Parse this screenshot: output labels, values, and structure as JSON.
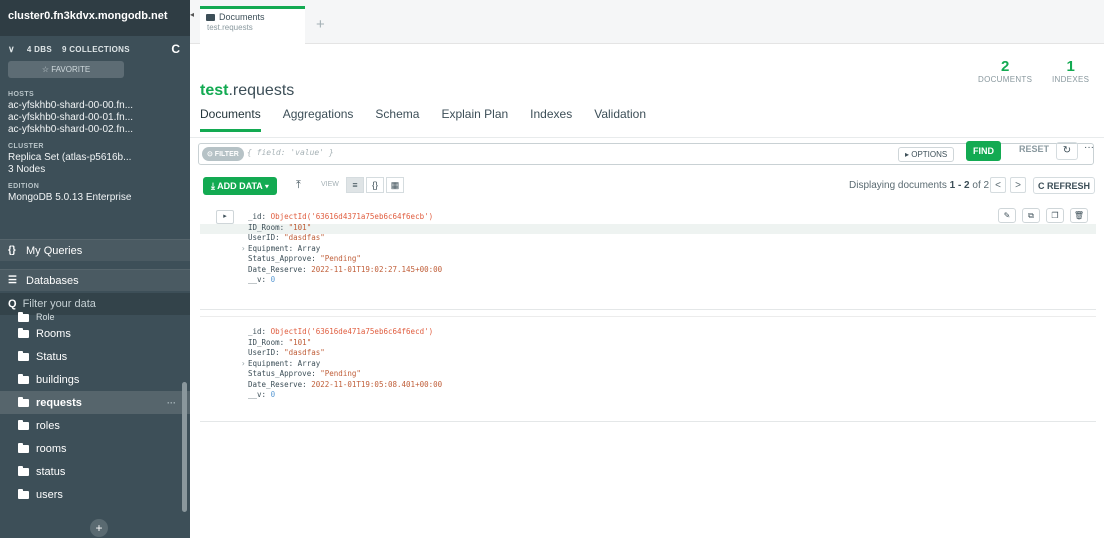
{
  "sidebar": {
    "cluster": "cluster0.fn3kdvx.mongodb.net",
    "dbs_label": "4 DBS",
    "collections_label": "9 COLLECTIONS",
    "favorite_label": "☆ FAVORITE",
    "hosts_label": "HOSTS",
    "hosts": [
      "ac-yfskhb0-shard-00-00.fn...",
      "ac-yfskhb0-shard-00-01.fn...",
      "ac-yfskhb0-shard-00-02.fn..."
    ],
    "cluster_label": "CLUSTER",
    "cluster_value": "Replica Set (atlas-p5616b...",
    "cluster_nodes": "3 Nodes",
    "edition_label": "EDITION",
    "edition_value": "MongoDB 5.0.13 Enterprise",
    "my_queries": "My Queries",
    "databases": "Databases",
    "filter_placeholder": "Filter your data",
    "partial_item": "Role",
    "collections": [
      {
        "label": "Rooms"
      },
      {
        "label": "Status"
      },
      {
        "label": "buildings"
      },
      {
        "label": "requests"
      },
      {
        "label": "roles"
      },
      {
        "label": "rooms"
      },
      {
        "label": "status"
      },
      {
        "label": "users"
      }
    ],
    "add_button": "+"
  },
  "tabs": {
    "active_title": "Documents",
    "active_sub": "test.requests",
    "new_tab": "+"
  },
  "header": {
    "db": "test",
    "collection": ".requests",
    "documents_count": "2",
    "documents_label": "DOCUMENTS",
    "indexes_count": "1",
    "indexes_label": "INDEXES",
    "subtabs": [
      "Documents",
      "Aggregations",
      "Schema",
      "Explain Plan",
      "Indexes",
      "Validation"
    ]
  },
  "query": {
    "filter_label": "⊙ FILTER",
    "placeholder": "{ field: 'value' }",
    "options_label": "▸ OPTIONS",
    "find_label": "FIND",
    "reset_label": "RESET",
    "history_icon": "↻",
    "more_icon": "···"
  },
  "toolbar": {
    "add_data": "⤓ ADD DATA ▾",
    "export_icon": "⤒",
    "view_label": "VIEW",
    "view_list": "≡",
    "view_json": "{}",
    "view_table": "▦",
    "display_prefix": "Displaying documents ",
    "display_range": "1 - 2",
    "display_of": " of 2",
    "prev": "<",
    "next": ">",
    "refresh": "C REFRESH"
  },
  "documents": [
    {
      "id_key": "_id:",
      "id_val": "ObjectId('63616d4371a75eb6c64f6ecb')",
      "room_key": "ID_Room:",
      "room_val": "\"101\"",
      "user_key": "UserID:",
      "user_val": "\"dasdfas\"",
      "equip_key": "Equipment:",
      "equip_val": "Array",
      "status_key": "Status_Approve:",
      "status_val": "\"Pending\"",
      "date_key": "Date_Reserve:",
      "date_val": "2022-11-01T19:02:27.145+00:00",
      "v_key": "__v:",
      "v_val": "0"
    },
    {
      "id_key": "_id:",
      "id_val": "ObjectId('63616de471a75eb6c64f6ecd')",
      "room_key": "ID_Room:",
      "room_val": "\"101\"",
      "user_key": "UserID:",
      "user_val": "\"dasdfas\"",
      "equip_key": "Equipment:",
      "equip_val": "Array",
      "status_key": "Status_Approve:",
      "status_val": "\"Pending\"",
      "date_key": "Date_Reserve:",
      "date_val": "2022-11-01T19:05:08.401+00:00",
      "v_key": "__v:",
      "v_val": "0"
    }
  ],
  "colors": {
    "accent": "#13aa52",
    "sidebar": "#3d4f58",
    "objectid": "#e05d3f",
    "string": "#c05f3a",
    "number": "#5c9bd4"
  }
}
